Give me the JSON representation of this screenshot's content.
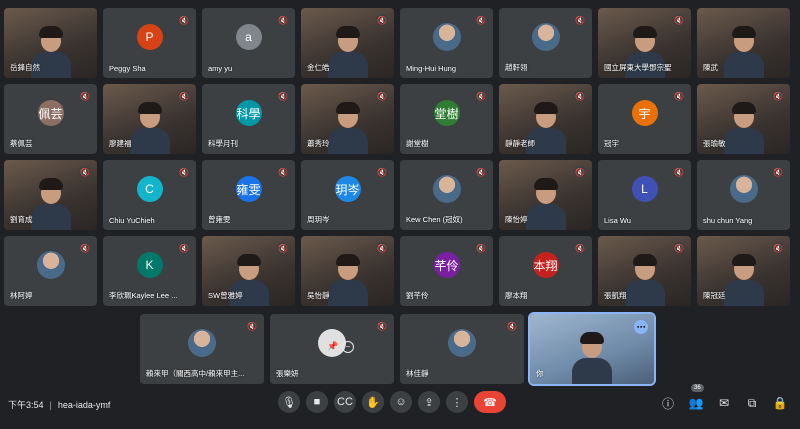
{
  "tiles": [
    {
      "name": "岳鋒自然",
      "type": "video",
      "muted": false
    },
    {
      "name": "Peggy Sha",
      "type": "avatar",
      "initial": "P",
      "color": "#d84315",
      "muted": true
    },
    {
      "name": "amy yu",
      "type": "avatar",
      "initial": "a",
      "color": "#80868b",
      "muted": true
    },
    {
      "name": "金仁皓",
      "type": "video",
      "muted": true
    },
    {
      "name": "Ming-Hui Hung",
      "type": "photo",
      "muted": true
    },
    {
      "name": "趙軒翎",
      "type": "photo",
      "muted": true
    },
    {
      "name": "國立屏東大學鄧宗聖",
      "type": "video",
      "muted": true
    },
    {
      "name": "陳武",
      "type": "video",
      "muted": false
    },
    {
      "name": "蔡佩芸",
      "type": "avatar",
      "initial": "佩芸",
      "color": "#8d6e63",
      "muted": true
    },
    {
      "name": "廖建福",
      "type": "video",
      "muted": true
    },
    {
      "name": "科學月刊",
      "type": "avatar",
      "initial": "科學",
      "color": "#0097a7",
      "muted": true
    },
    {
      "name": "蕭秀玲",
      "type": "video",
      "muted": true
    },
    {
      "name": "謝堂樹",
      "type": "avatar",
      "initial": "堂樹",
      "color": "#2e7d32",
      "muted": true
    },
    {
      "name": "靜靜老師",
      "type": "video",
      "muted": true
    },
    {
      "name": "冠宇",
      "type": "avatar",
      "initial": "宇",
      "color": "#e8710a",
      "muted": true
    },
    {
      "name": "張瑜敏",
      "type": "video",
      "muted": true
    },
    {
      "name": "劉育成",
      "type": "video",
      "muted": true
    },
    {
      "name": "Chiu YuChieh",
      "type": "avatar",
      "initial": "C",
      "color": "#12b5cb",
      "muted": true
    },
    {
      "name": "曾雍雯",
      "type": "avatar",
      "initial": "雍雯",
      "color": "#1a73e8",
      "muted": true
    },
    {
      "name": "周玥岑",
      "type": "avatar",
      "initial": "玥岑",
      "color": "#1e88e5",
      "muted": true
    },
    {
      "name": "Kew Chen (冠奴)",
      "type": "photo",
      "muted": true
    },
    {
      "name": "陳怡婷",
      "type": "video",
      "muted": true
    },
    {
      "name": "Lisa Wu",
      "type": "avatar",
      "initial": "L",
      "color": "#3f51b5",
      "muted": true
    },
    {
      "name": "shu chun Yang",
      "type": "photo",
      "muted": true
    },
    {
      "name": "林阿婷",
      "type": "photo",
      "muted": true
    },
    {
      "name": "李欣珮Kaylee Lee ...",
      "type": "avatar",
      "initial": "K",
      "color": "#00796b",
      "muted": true
    },
    {
      "name": "SW曾雅婷",
      "type": "video",
      "muted": true
    },
    {
      "name": "吳怡靜",
      "type": "video",
      "muted": true
    },
    {
      "name": "劉芊伶",
      "type": "avatar",
      "initial": "芊伶",
      "color": "#7b1fa2",
      "muted": true
    },
    {
      "name": "廖本翔",
      "type": "avatar",
      "initial": "本翔",
      "color": "#c5221f",
      "muted": true
    },
    {
      "name": "張凱翔",
      "type": "video",
      "muted": true
    },
    {
      "name": "陳冠廷",
      "type": "video",
      "muted": true
    }
  ],
  "bottom_tiles": [
    {
      "name": "賴來甲（關西高中/賴來甲主...",
      "type": "photo",
      "muted": true
    },
    {
      "name": "張樂妍",
      "type": "pinned",
      "muted": true
    },
    {
      "name": "林佳靜",
      "type": "photo",
      "muted": true
    },
    {
      "name": "你",
      "type": "self",
      "muted": false
    }
  ],
  "meeting": {
    "time": "下午3:54",
    "separator": "|",
    "code": "hea-iada-ymf"
  },
  "controls": [
    {
      "id": "mic",
      "icon": "microphone-icon",
      "glyph": "🎙"
    },
    {
      "id": "camera",
      "icon": "camera-icon",
      "glyph": "■"
    },
    {
      "id": "captions",
      "icon": "captions-icon",
      "glyph": "CC"
    },
    {
      "id": "hand",
      "icon": "raise-hand-icon",
      "glyph": "✋"
    },
    {
      "id": "emoji",
      "icon": "emoji-icon",
      "glyph": "☺"
    },
    {
      "id": "present",
      "icon": "present-screen-icon",
      "glyph": "⇪"
    },
    {
      "id": "more",
      "icon": "more-options-icon",
      "glyph": "⋮"
    }
  ],
  "hangup": {
    "icon": "hang-up-icon",
    "glyph": "☎"
  },
  "side": {
    "info_glyph": "ⓘ",
    "people_glyph": "👥",
    "people_count": "36",
    "chat_glyph": "✉",
    "activities_glyph": "⧉",
    "security_glyph": "🔒"
  },
  "colors": {
    "background": "#202124",
    "tile": "#3c4043",
    "hangup": "#ea4335",
    "active_outline": "#8ab4f8"
  }
}
